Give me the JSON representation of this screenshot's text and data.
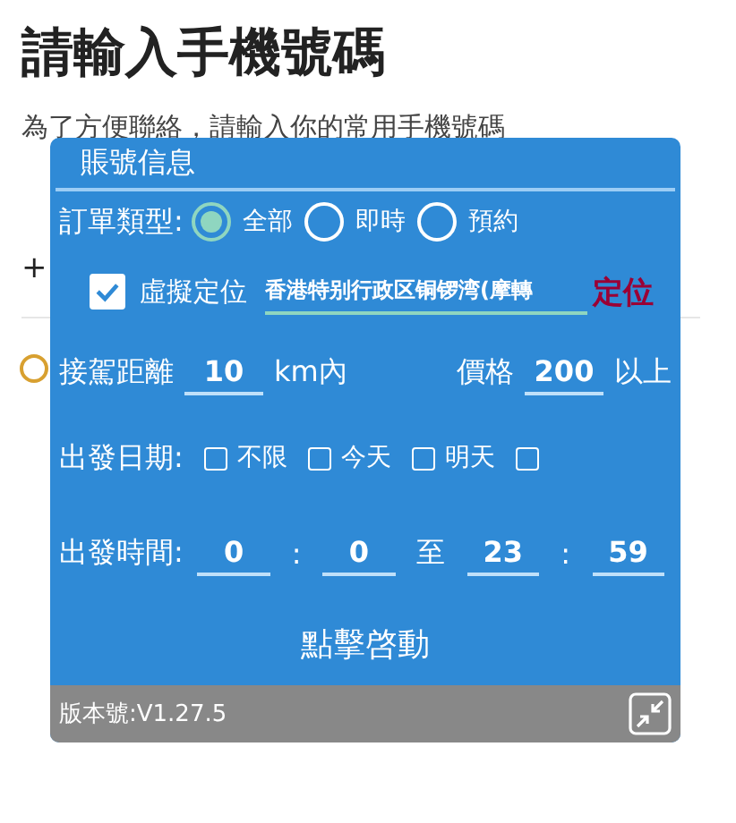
{
  "page": {
    "title": "請輸入手機號碼",
    "subtitle": "為了方便聯絡，請輸入你的常用手機號碼",
    "phone_prefix": "+",
    "agree_checked": false
  },
  "panel": {
    "title": "賬號信息",
    "order_type": {
      "label": "訂單類型:",
      "options": [
        {
          "label": "全部",
          "selected": true
        },
        {
          "label": "即時",
          "selected": false
        },
        {
          "label": "預約",
          "selected": false
        }
      ]
    },
    "location": {
      "label": "虛擬定位",
      "checked": true,
      "value": "香港特别行政区铜锣湾(摩轉",
      "button": "定位"
    },
    "distance": {
      "label": "接駕距離",
      "value": "10",
      "unit": "km內"
    },
    "price": {
      "label": "價格",
      "value": "200",
      "unit": "以上"
    },
    "date": {
      "label": "出發日期:",
      "options": [
        {
          "label": "不限",
          "checked": false
        },
        {
          "label": "今天",
          "checked": false
        },
        {
          "label": "明天",
          "checked": false
        },
        {
          "checked": false
        }
      ]
    },
    "time": {
      "label": "出發時間:",
      "from_hour": "0",
      "sep1": ":",
      "from_min": "0",
      "to": "至",
      "to_hour": "23",
      "sep2": ":",
      "to_min": "59"
    },
    "start_button": "點擊啓動",
    "version": "版本號:V1.27.5"
  }
}
